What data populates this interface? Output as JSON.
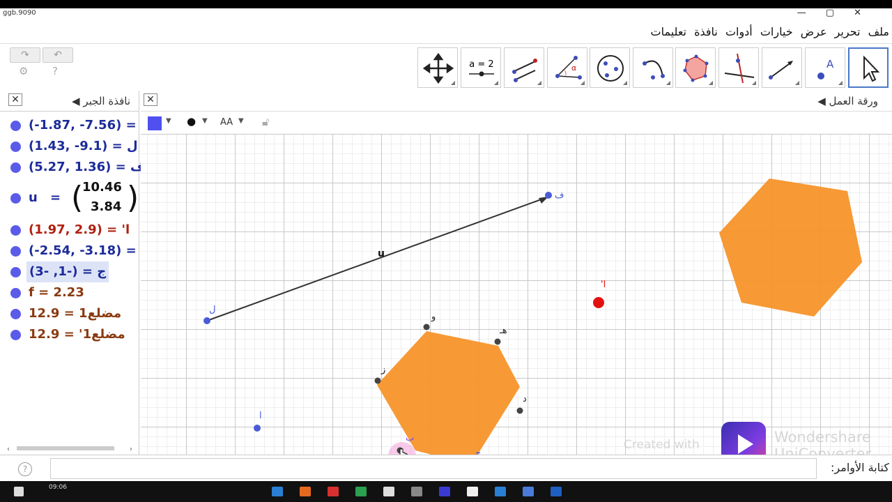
{
  "window": {
    "title": "ggb.9090",
    "controls": [
      "—",
      "▢",
      "✕"
    ]
  },
  "menu": {
    "items": [
      "ملف",
      "تحرير",
      "عرض",
      "خيارات",
      "أدوات",
      "نافذة",
      "تعليمات"
    ]
  },
  "toolbar": {
    "undo_icon": "undo-icon",
    "redo_icon": "redo-icon",
    "settings_icon": "gear-icon",
    "help_icon": "help-icon",
    "tools": [
      {
        "name": "move-graphics-view-tool",
        "label": ""
      },
      {
        "name": "slider-tool",
        "label": "a = 2"
      },
      {
        "name": "reflect-tool",
        "label": ""
      },
      {
        "name": "angle-tool",
        "label": "α"
      },
      {
        "name": "circle-tool",
        "label": ""
      },
      {
        "name": "arc-tool",
        "label": ""
      },
      {
        "name": "polygon-tool",
        "label": ""
      },
      {
        "name": "perpendicular-line-tool",
        "label": ""
      },
      {
        "name": "line-tool",
        "label": ""
      },
      {
        "name": "point-tool",
        "label": "A"
      },
      {
        "name": "move-tool",
        "label": ""
      }
    ]
  },
  "algebra": {
    "title": "نافذة الجبر",
    "rows": [
      {
        "text": "= (-1.87, -7.56)",
        "display": "(-1.87, -7.56) =",
        "color": "blue"
      },
      {
        "text": "(1.43, -9.1) = ل",
        "display": "(1.43, -9.1) = ل",
        "color": "blue"
      },
      {
        "text": "(5.27, 1.36) = ف",
        "display": "(5.27, 1.36) = ف",
        "color": "blue"
      },
      {
        "text": "u = (10.46, 3.84)",
        "display": "u",
        "vec_top": "10.46",
        "vec_bottom": "3.84",
        "color": "blue"
      },
      {
        "text": "(1.97, 2.9) = 'ا",
        "display": "(1.97, 2.9) = 'ا",
        "color": "red"
      },
      {
        "text": "= (-2.54, -3.18)",
        "display": "(-2.54, -3.18) =",
        "color": "blue"
      },
      {
        "text": "ج = (-1, -3)",
        "display": "ج = (-1, -3)",
        "color": "blue",
        "selected": true
      },
      {
        "text": "f = 2.23",
        "display": "f = 2.23",
        "color": "brown"
      },
      {
        "text": "مضلع1 = 12.9",
        "display": "مضلع1 = 12.9",
        "color": "brown"
      },
      {
        "text": "مضلع1' = 12.9",
        "display": "مضلع1' = 12.9",
        "color": "brown"
      }
    ]
  },
  "graphics": {
    "title": "ورقة العمل",
    "style_bar": {
      "color": "#5050f0",
      "point_style": "●",
      "text_size": "AA"
    },
    "point_labels": {
      "L": "ل",
      "F": "ف",
      "A": "ا",
      "A_prime": "'ا",
      "W": "و",
      "H": "هـ",
      "Z": "ز",
      "D": "د",
      "B": "ب",
      "J": "ج",
      "vector": "u"
    }
  },
  "input_bar": {
    "label": "كتابة الأوامر:",
    "help_icon": "help-icon"
  },
  "watermark": {
    "created_with": "Created with",
    "brand1": "Wondershare",
    "brand2": "UniConverter"
  },
  "taskbar": {
    "time": "09:06"
  },
  "colors": {
    "hexagon": "#f7942a",
    "point_blue": "#4a5bd8",
    "point_red": "#e31010",
    "vector": "#333333"
  }
}
